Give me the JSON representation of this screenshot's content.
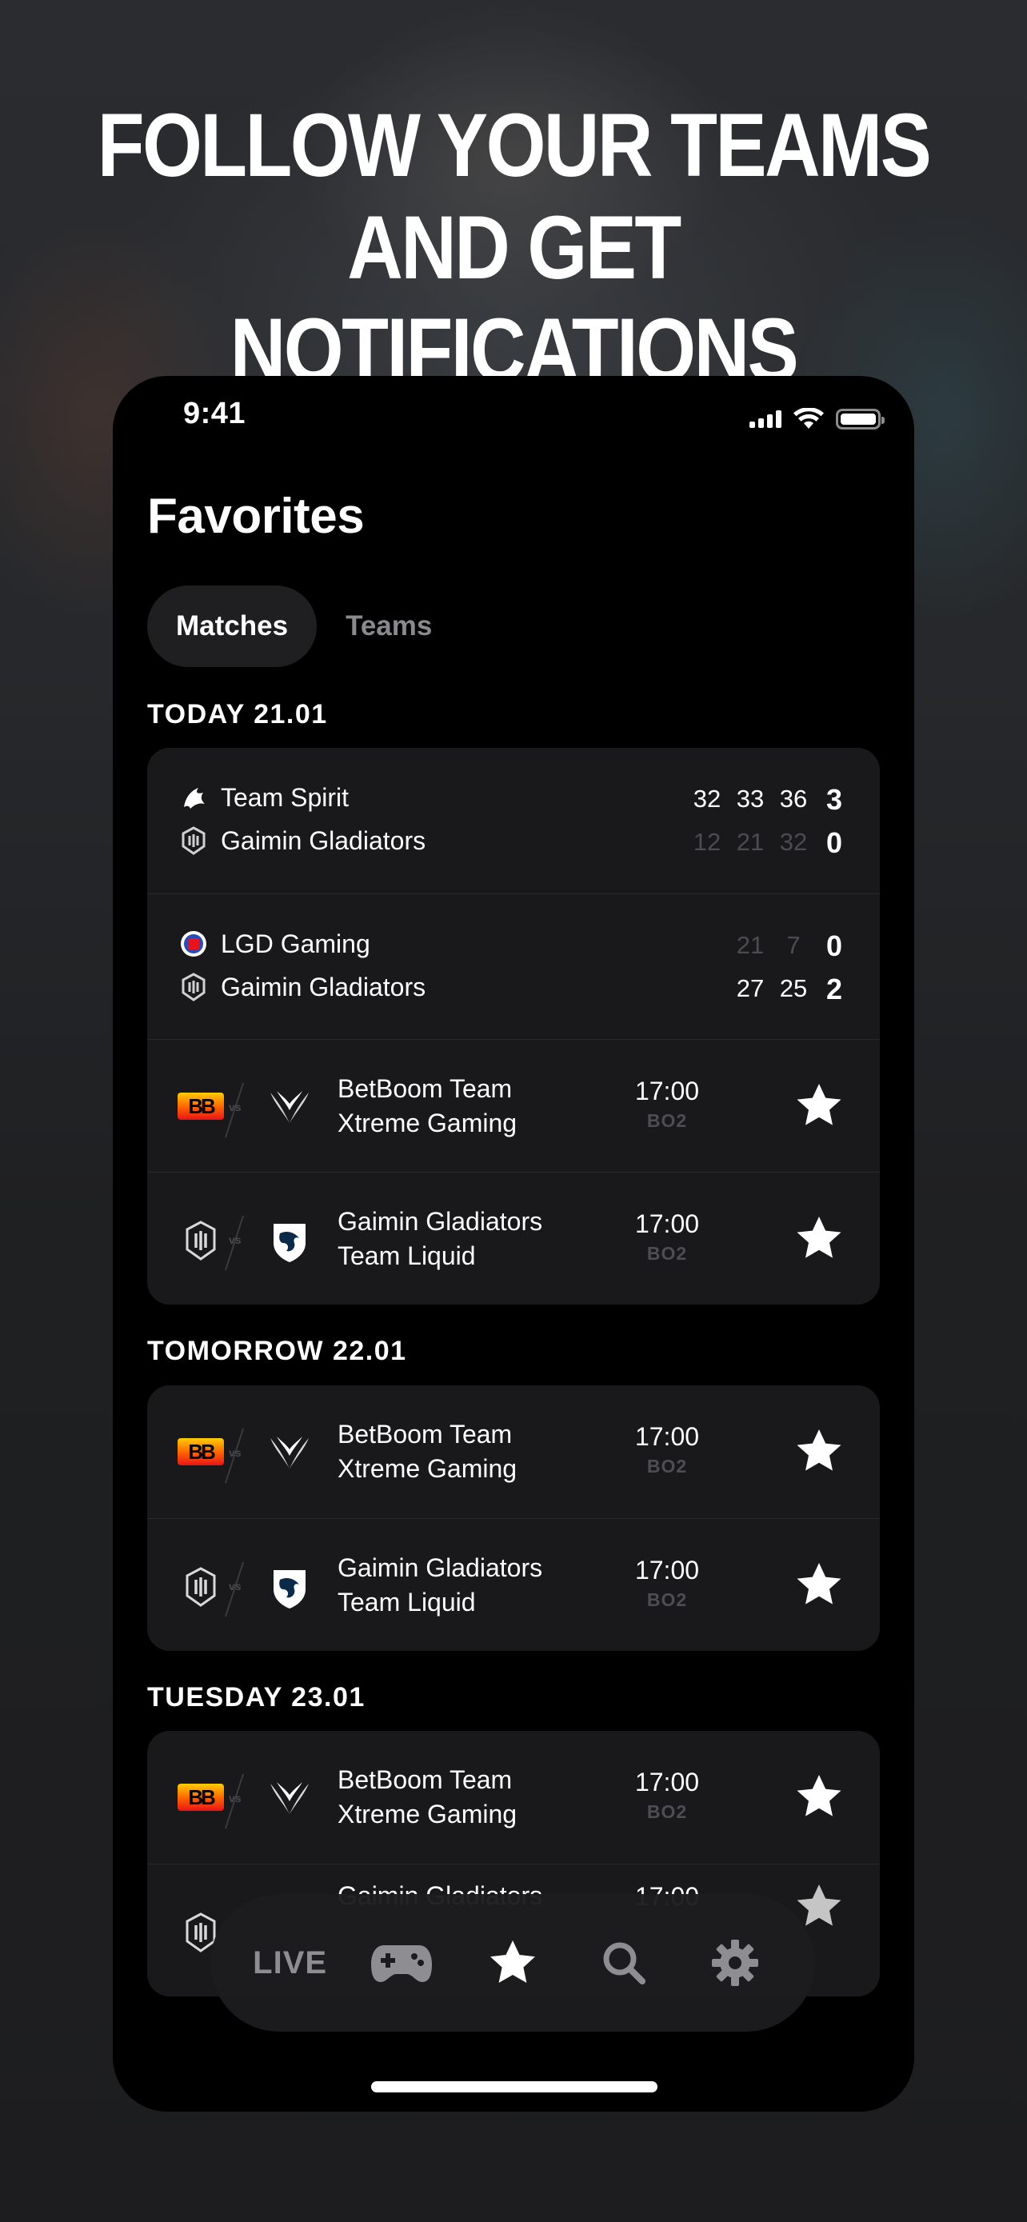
{
  "headline": {
    "line1": "FOLLOW YOUR TEAMS",
    "line2": "AND GET NOTIFICATIONS"
  },
  "status_bar": {
    "time": "9:41",
    "icons": [
      "signal-icon",
      "wifi-icon",
      "battery-icon"
    ]
  },
  "page_title": "Favorites",
  "tabs": [
    {
      "label": "Matches",
      "active": true
    },
    {
      "label": "Teams",
      "active": false
    }
  ],
  "sections": [
    {
      "label": "TODAY 21.01",
      "score_matches": [
        {
          "team1": {
            "name": "Team Spirit",
            "maps": [
              "32",
              "33",
              "36"
            ],
            "total": "3"
          },
          "team2": {
            "name": "Gaimin Gladiators",
            "maps": [
              "12",
              "21",
              "32"
            ],
            "total": "0"
          }
        },
        {
          "team1": {
            "name": "LGD Gaming",
            "maps": [
              "21",
              "7"
            ],
            "total": "0"
          },
          "team2": {
            "name": "Gaimin Gladiators",
            "maps": [
              "27",
              "25"
            ],
            "total": "2"
          }
        }
      ],
      "upcoming": [
        {
          "team1": "BetBoom Team",
          "team2": "Xtreme Gaming",
          "time": "17:00",
          "format": "BO2"
        },
        {
          "team1": "Gaimin Gladiators",
          "team2": "Team Liquid",
          "time": "17:00",
          "format": "BO2"
        }
      ]
    },
    {
      "label": "TOMORROW 22.01",
      "upcoming": [
        {
          "team1": "BetBoom Team",
          "team2": "Xtreme Gaming",
          "time": "17:00",
          "format": "BO2"
        },
        {
          "team1": "Gaimin Gladiators",
          "team2": "Team Liquid",
          "time": "17:00",
          "format": "BO2"
        }
      ]
    },
    {
      "label": "TUESDAY 23.01",
      "upcoming": [
        {
          "team1": "BetBoom Team",
          "team2": "Xtreme Gaming",
          "time": "17:00",
          "format": "BO2"
        },
        {
          "team1": "Gaimin Gladiators",
          "team2": "",
          "time": "17:00",
          "format": ""
        }
      ]
    }
  ],
  "bottom_nav": {
    "live_label": "LIVE",
    "items": [
      "live-tab",
      "gamepad-icon",
      "star-icon",
      "search-icon",
      "gear-icon"
    ],
    "active": "star-icon"
  },
  "colors": {
    "accent": "#ffffff",
    "card": "#19191b",
    "dim_text": "#4c4c50",
    "background": "#000000"
  }
}
